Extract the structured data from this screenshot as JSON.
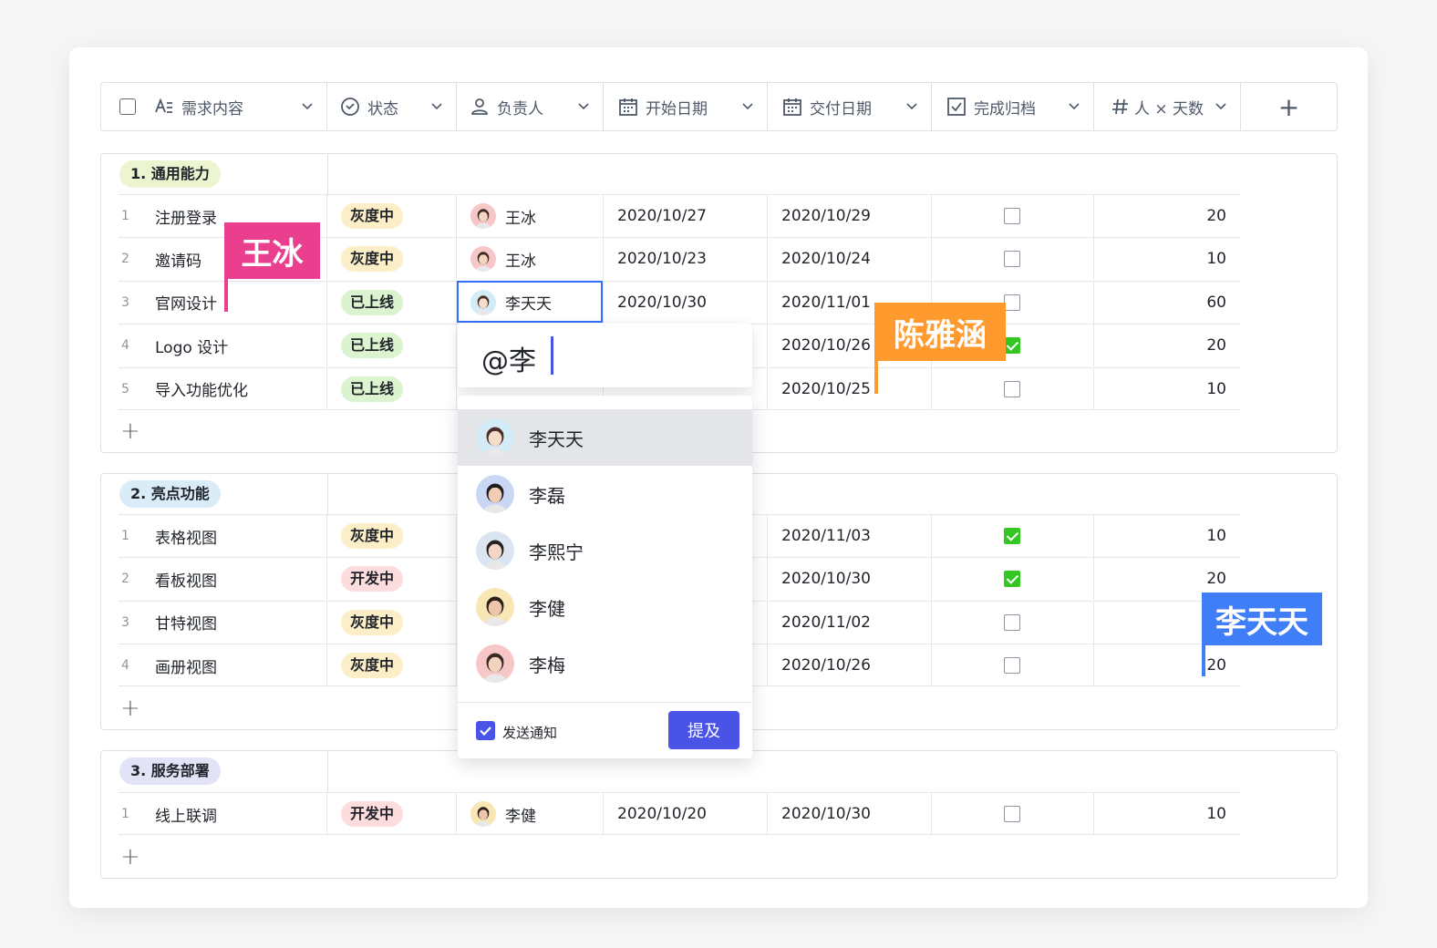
{
  "header": {
    "columns": [
      "需求内容",
      "状态",
      "负责人",
      "开始日期",
      "交付日期",
      "完成归档",
      "人 × 天数"
    ],
    "add_label": "+"
  },
  "groups": [
    {
      "title": "1. 通用能力",
      "color": "#ecf4d0",
      "rows": [
        {
          "idx": "1",
          "name": "注册登录",
          "status": "灰度中",
          "owner": "王冰",
          "start": "2020/10/27",
          "end": "2020/10/29",
          "done": false,
          "days": "20"
        },
        {
          "idx": "2",
          "name": "邀请码",
          "status": "灰度中",
          "owner": "王冰",
          "start": "2020/10/23",
          "end": "2020/10/24",
          "done": false,
          "days": "10"
        },
        {
          "idx": "3",
          "name": "官网设计",
          "status": "已上线",
          "owner": "李天天",
          "start": "2020/10/30",
          "end": "2020/11/01",
          "done": false,
          "days": "60"
        },
        {
          "idx": "4",
          "name": "Logo 设计",
          "status": "已上线",
          "owner": "",
          "start": "",
          "end": "2020/10/26",
          "done": true,
          "days": "20"
        },
        {
          "idx": "5",
          "name": "导入功能优化",
          "status": "已上线",
          "owner": "",
          "start": "",
          "end": "2020/10/25",
          "done": false,
          "days": "10"
        }
      ]
    },
    {
      "title": "2. 亮点功能",
      "color": "#d9ecf8",
      "rows": [
        {
          "idx": "1",
          "name": "表格视图",
          "status": "灰度中",
          "end": "2020/11/03",
          "done": true,
          "days": "10"
        },
        {
          "idx": "2",
          "name": "看板视图",
          "status": "开发中",
          "end": "2020/10/30",
          "done": true,
          "days": "20"
        },
        {
          "idx": "3",
          "name": "甘特视图",
          "status": "灰度中",
          "end": "2020/11/02",
          "done": false,
          "days": ""
        },
        {
          "idx": "4",
          "name": "画册视图",
          "status": "灰度中",
          "end": "2020/10/26",
          "done": false,
          "days": "20"
        }
      ]
    },
    {
      "title": "3. 服务部署",
      "color": "#e3e3f7",
      "rows": [
        {
          "idx": "1",
          "name": "线上联调",
          "status": "开发中",
          "owner": "李健",
          "start": "2020/10/20",
          "end": "2020/10/30",
          "done": false,
          "days": "10"
        }
      ]
    }
  ],
  "status_colors": {
    "灰度中": {
      "bg": "#fcefc7",
      "fg": "#1f2329"
    },
    "已上线": {
      "bg": "#dcf3cf",
      "fg": "#1f2329"
    },
    "开发中": {
      "bg": "#fcdcdc",
      "fg": "#1f2329"
    }
  },
  "flags": {
    "wangbing": {
      "label": "王冰",
      "color": "#e93f8e"
    },
    "chenyahan": {
      "label": "陈雅涵",
      "color": "#ff9a2e"
    },
    "litiantian": {
      "label": "李天天",
      "color": "#3f7ef7"
    }
  },
  "mention": {
    "input_value": "@李",
    "options": [
      "李天天",
      "李磊",
      "李熙宁",
      "李健",
      "李梅"
    ],
    "notify_label": "发送通知",
    "submit_label": "提及",
    "accent": "#4953e6"
  },
  "add_row_label": "+"
}
